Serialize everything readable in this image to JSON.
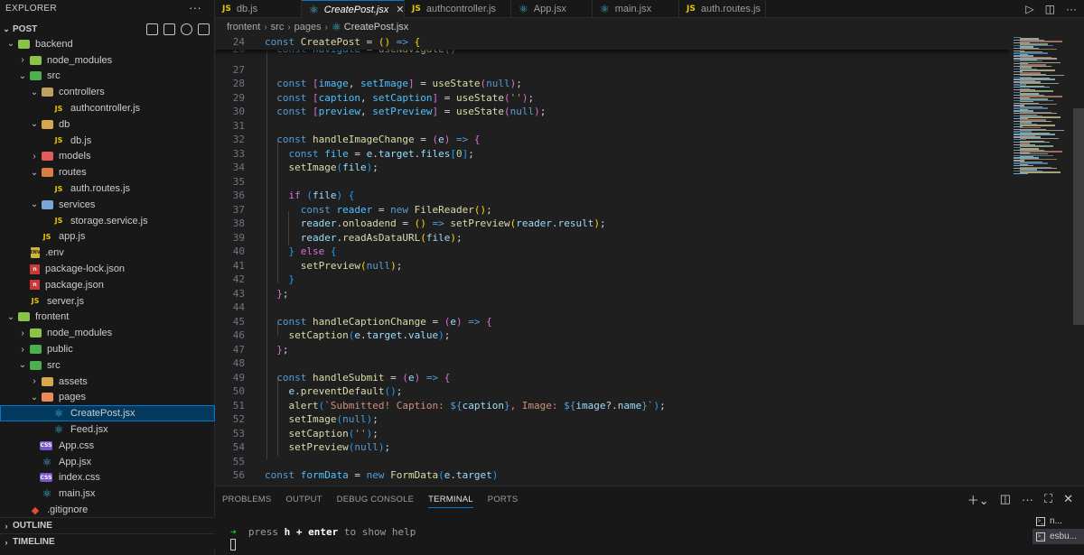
{
  "sidebar": {
    "title": "EXPLORER",
    "more": "···",
    "project": "POST",
    "tree": [
      {
        "label": "backend",
        "depth": 0,
        "type": "folder",
        "open": true,
        "color": "#8bc34a"
      },
      {
        "label": "node_modules",
        "depth": 1,
        "type": "folder",
        "open": false,
        "color": "#8bc34a"
      },
      {
        "label": "src",
        "depth": 1,
        "type": "folder",
        "open": true,
        "color": "#4caf50"
      },
      {
        "label": "controllers",
        "depth": 2,
        "type": "folder",
        "open": true,
        "color": "#c0a060"
      },
      {
        "label": "authcontroller.js",
        "depth": 3,
        "type": "js"
      },
      {
        "label": "db",
        "depth": 2,
        "type": "folder",
        "open": true,
        "color": "#d4a84b"
      },
      {
        "label": "db.js",
        "depth": 3,
        "type": "js"
      },
      {
        "label": "models",
        "depth": 2,
        "type": "folder",
        "open": false,
        "color": "#e05b5b"
      },
      {
        "label": "routes",
        "depth": 2,
        "type": "folder",
        "open": true,
        "color": "#d77d45"
      },
      {
        "label": "auth.routes.js",
        "depth": 3,
        "type": "js"
      },
      {
        "label": "services",
        "depth": 2,
        "type": "folder",
        "open": true,
        "color": "#7aa5d8"
      },
      {
        "label": "storage.service.js",
        "depth": 3,
        "type": "js"
      },
      {
        "label": "app.js",
        "depth": 2,
        "type": "js"
      },
      {
        "label": ".env",
        "depth": 1,
        "type": "env"
      },
      {
        "label": "package-lock.json",
        "depth": 1,
        "type": "npm"
      },
      {
        "label": "package.json",
        "depth": 1,
        "type": "npm"
      },
      {
        "label": "server.js",
        "depth": 1,
        "type": "js"
      },
      {
        "label": "frontent",
        "depth": 0,
        "type": "folder",
        "open": true,
        "color": "#8bc34a"
      },
      {
        "label": "node_modules",
        "depth": 1,
        "type": "folder",
        "open": false,
        "color": "#8bc34a"
      },
      {
        "label": "public",
        "depth": 1,
        "type": "folder",
        "open": false,
        "color": "#4caf50"
      },
      {
        "label": "src",
        "depth": 1,
        "type": "folder",
        "open": true,
        "color": "#4caf50"
      },
      {
        "label": "assets",
        "depth": 2,
        "type": "folder",
        "open": false,
        "color": "#d4a84b"
      },
      {
        "label": "pages",
        "depth": 2,
        "type": "folder",
        "open": true,
        "color": "#e88a5a"
      },
      {
        "label": "CreatePost.jsx",
        "depth": 3,
        "type": "react",
        "selected": true
      },
      {
        "label": "Feed.jsx",
        "depth": 3,
        "type": "react"
      },
      {
        "label": "App.css",
        "depth": 2,
        "type": "css"
      },
      {
        "label": "App.jsx",
        "depth": 2,
        "type": "react"
      },
      {
        "label": "index.css",
        "depth": 2,
        "type": "css"
      },
      {
        "label": "main.jsx",
        "depth": 2,
        "type": "react"
      },
      {
        "label": ".gitignore",
        "depth": 1,
        "type": "git"
      }
    ],
    "outline": "OUTLINE",
    "timeline": "TIMELINE"
  },
  "tabs": [
    {
      "label": "db.js",
      "icon": "js",
      "active": false
    },
    {
      "label": "CreatePost.jsx",
      "icon": "react",
      "active": true
    },
    {
      "label": "authcontroller.js",
      "icon": "js",
      "active": false
    },
    {
      "label": "App.jsx",
      "icon": "react",
      "active": false
    },
    {
      "label": "main.jsx",
      "icon": "react",
      "active": false
    },
    {
      "label": "auth.routes.js",
      "icon": "js",
      "active": false
    }
  ],
  "breadcrumb": [
    "frontent",
    "src",
    "pages",
    "CreatePost.jsx"
  ],
  "code": [
    {
      "n": "24",
      "html": "<span class=\"k\">const</span> <span class=\"f\">CreatePost</span> = <span class=\"p\">()</span> <span class=\"k\">=&gt;</span> <span class=\"p\">{</span>",
      "sticky": true
    },
    {
      "n": "26",
      "html": "  <span class=\"k\">const</span> <span class=\"c\">navigate</span> = <span class=\"f\">useNavigate</span><span class=\"p2\">()</span>",
      "partial": true
    },
    {
      "n": "27",
      "html": ""
    },
    {
      "n": "28",
      "html": "  <span class=\"k\">const</span> <span class=\"p2\">[</span><span class=\"c\">image</span>, <span class=\"c\">setImage</span><span class=\"p2\">]</span> = <span class=\"f\">useState</span><span class=\"p2\">(</span><span class=\"k\">null</span><span class=\"p2\">)</span>;"
    },
    {
      "n": "29",
      "html": "  <span class=\"k\">const</span> <span class=\"p2\">[</span><span class=\"c\">caption</span>, <span class=\"c\">setCaption</span><span class=\"p2\">]</span> = <span class=\"f\">useState</span><span class=\"p2\">(</span><span class=\"s\">''</span><span class=\"p2\">)</span>;"
    },
    {
      "n": "30",
      "html": "  <span class=\"k\">const</span> <span class=\"p2\">[</span><span class=\"c\">preview</span>, <span class=\"c\">setPreview</span><span class=\"p2\">]</span> = <span class=\"f\">useState</span><span class=\"p2\">(</span><span class=\"k\">null</span><span class=\"p2\">)</span>;"
    },
    {
      "n": "31",
      "html": ""
    },
    {
      "n": "32",
      "html": "  <span class=\"k\">const</span> <span class=\"f\">handleImageChange</span> = <span class=\"p2\">(</span><span class=\"v\">e</span><span class=\"p2\">)</span> <span class=\"k\">=&gt;</span> <span class=\"p2\">{</span>"
    },
    {
      "n": "33",
      "html": "    <span class=\"k\">const</span> <span class=\"c\">file</span> = <span class=\"v\">e</span>.<span class=\"v\">target</span>.<span class=\"v\">files</span><span class=\"p3\">[</span><span class=\"n\">0</span><span class=\"p3\">]</span>;"
    },
    {
      "n": "34",
      "html": "    <span class=\"f\">setImage</span><span class=\"p3\">(</span><span class=\"v\">file</span><span class=\"p3\">)</span>;"
    },
    {
      "n": "35",
      "html": ""
    },
    {
      "n": "36",
      "html": "    <span class=\"p2\">if</span> <span class=\"p3\">(</span><span class=\"v\">file</span><span class=\"p3\">)</span> <span class=\"p3\">{</span>"
    },
    {
      "n": "37",
      "html": "      <span class=\"k\">const</span> <span class=\"c\">reader</span> = <span class=\"k\">new</span> <span class=\"f\">FileReader</span><span class=\"p\">()</span>;"
    },
    {
      "n": "38",
      "html": "      <span class=\"v\">reader</span>.<span class=\"f\">onloadend</span> = <span class=\"p\">()</span> <span class=\"k\">=&gt;</span> <span class=\"f\">setPreview</span><span class=\"p\">(</span><span class=\"v\">reader</span>.<span class=\"v\">result</span><span class=\"p\">)</span>;"
    },
    {
      "n": "39",
      "html": "      <span class=\"v\">reader</span>.<span class=\"f\">readAsDataURL</span><span class=\"p\">(</span><span class=\"v\">file</span><span class=\"p\">)</span>;"
    },
    {
      "n": "40",
      "html": "    <span class=\"p3\">}</span> <span class=\"p2\">else</span> <span class=\"p3\">{</span>"
    },
    {
      "n": "41",
      "html": "      <span class=\"f\">setPreview</span><span class=\"p\">(</span><span class=\"k\">null</span><span class=\"p\">)</span>;"
    },
    {
      "n": "42",
      "html": "    <span class=\"p3\">}</span>"
    },
    {
      "n": "43",
      "html": "  <span class=\"p2\">}</span>;"
    },
    {
      "n": "44",
      "html": ""
    },
    {
      "n": "45",
      "html": "  <span class=\"k\">const</span> <span class=\"f\">handleCaptionChange</span> = <span class=\"p2\">(</span><span class=\"v\">e</span><span class=\"p2\">)</span> <span class=\"k\">=&gt;</span> <span class=\"p2\">{</span>"
    },
    {
      "n": "46",
      "html": "    <span class=\"f\">setCaption</span><span class=\"p3\">(</span><span class=\"v\">e</span>.<span class=\"v\">target</span>.<span class=\"v\">value</span><span class=\"p3\">)</span>;"
    },
    {
      "n": "47",
      "html": "  <span class=\"p2\">}</span>;"
    },
    {
      "n": "48",
      "html": ""
    },
    {
      "n": "49",
      "html": "  <span class=\"k\">const</span> <span class=\"f\">handleSubmit</span> = <span class=\"p2\">(</span><span class=\"v\">e</span><span class=\"p2\">)</span> <span class=\"k\">=&gt;</span> <span class=\"p2\">{</span>"
    },
    {
      "n": "50",
      "html": "    <span class=\"v\">e</span>.<span class=\"f\">preventDefault</span><span class=\"p3\">()</span>;"
    },
    {
      "n": "51",
      "html": "    <span class=\"f\">alert</span><span class=\"p3\">(</span><span class=\"s\">`Submitted! Caption: </span><span class=\"k\">${</span><span class=\"v\">caption</span><span class=\"k\">}</span><span class=\"s\">, Image: </span><span class=\"k\">${</span><span class=\"v\">image</span>?.<span class=\"v\">name</span><span class=\"k\">}</span><span class=\"s\">`</span><span class=\"p3\">)</span>;"
    },
    {
      "n": "52",
      "html": "    <span class=\"f\">setImage</span><span class=\"p3\">(</span><span class=\"k\">null</span><span class=\"p3\">)</span>;"
    },
    {
      "n": "53",
      "html": "    <span class=\"f\">setCaption</span><span class=\"p3\">(</span><span class=\"s\">''</span><span class=\"p3\">)</span>;"
    },
    {
      "n": "54",
      "html": "    <span class=\"f\">setPreview</span><span class=\"p3\">(</span><span class=\"k\">null</span><span class=\"p3\">)</span>;"
    },
    {
      "n": "55",
      "html": ""
    },
    {
      "n": "56",
      "html": "<span class=\"k\">const</span> <span class=\"c\">formData</span> = <span class=\"k\">new</span> <span class=\"f\">FormData</span><span class=\"p3\">(</span><span class=\"v\">e</span>.<span class=\"v\">target</span><span class=\"p3\">)</span>"
    }
  ],
  "panel": {
    "tabs": [
      "PROBLEMS",
      "OUTPUT",
      "DEBUG CONSOLE",
      "TERMINAL",
      "PORTS"
    ],
    "active_tab": "TERMINAL",
    "terminal": {
      "arrow": "➜",
      "press": "press",
      "key1": "h",
      "plus": "+",
      "key2": "enter",
      "rest": "to show help"
    },
    "terminals": [
      "n...",
      "esbu..."
    ]
  }
}
